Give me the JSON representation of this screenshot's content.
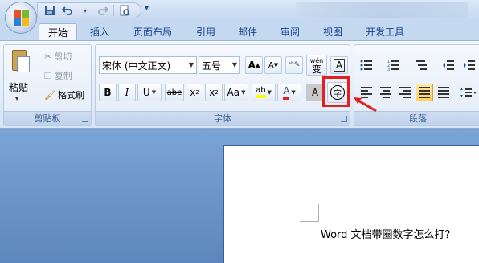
{
  "quick_access": {
    "save_icon": "save-icon",
    "undo_icon": "undo-icon",
    "redo_icon": "redo-icon",
    "preview_icon": "print-preview-icon"
  },
  "tabs": [
    {
      "label": "开始",
      "active": true
    },
    {
      "label": "插入"
    },
    {
      "label": "页面布局"
    },
    {
      "label": "引用"
    },
    {
      "label": "邮件"
    },
    {
      "label": "审阅"
    },
    {
      "label": "视图"
    },
    {
      "label": "开发工具"
    }
  ],
  "clipboard": {
    "paste": "粘贴",
    "cut": "剪切",
    "copy": "复制",
    "format_painter": "格式刷",
    "group_label": "剪贴板"
  },
  "font": {
    "font_name": "宋体 (中文正文)",
    "font_size": "五号",
    "bold": "B",
    "italic": "I",
    "underline": "U",
    "strikethrough": "abe",
    "subscript": "x",
    "sub_mark": "2",
    "superscript": "x",
    "sup_mark": "2",
    "change_case": "Aa",
    "highlight_text": "ab",
    "font_color": "A",
    "char_shading": "A",
    "enclosed_char": "字",
    "grow_font": "A",
    "shrink_font": "A",
    "phonetic_sample": "wén",
    "phonetic_char": "变",
    "char_border": "A",
    "group_label": "字体"
  },
  "paragraph": {
    "group_label": "段落"
  },
  "colors": {
    "accent": "#e51e1e",
    "highlight": "#ffff00",
    "font_red": "#e51e1e"
  },
  "document": {
    "text": "Word 文档带圈数字怎么打？"
  }
}
